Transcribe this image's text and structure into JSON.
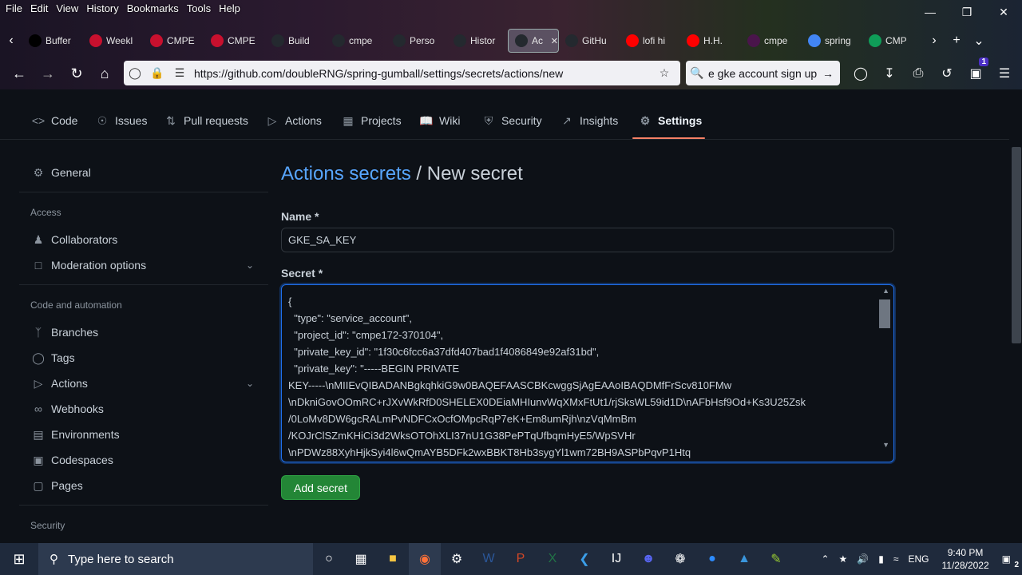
{
  "browser": {
    "menu": [
      "File",
      "Edit",
      "View",
      "History",
      "Bookmarks",
      "Tools",
      "Help"
    ],
    "tabs": [
      {
        "label": "Buffer",
        "color": "#000000"
      },
      {
        "label": "Weekl",
        "color": "#c8102e"
      },
      {
        "label": "CMPE",
        "color": "#c8102e"
      },
      {
        "label": "CMPE",
        "color": "#c8102e"
      },
      {
        "label": "Build",
        "color": "#24292f"
      },
      {
        "label": "cmpe",
        "color": "#24292f"
      },
      {
        "label": "Perso",
        "color": "#24292f"
      },
      {
        "label": "Histor",
        "color": "#24292f"
      },
      {
        "label": "Ac",
        "color": "#24292f",
        "active": true
      },
      {
        "label": "GitHu",
        "color": "#24292f"
      },
      {
        "label": "lofi hi",
        "color": "#ff0000"
      },
      {
        "label": "H.H.",
        "color": "#ff0000"
      },
      {
        "label": "cmpe",
        "color": "#4a154b"
      },
      {
        "label": "spring",
        "color": "#4285f4"
      },
      {
        "label": "CMP",
        "color": "#0f9d58"
      }
    ],
    "url": "https://github.com/doubleRNG/spring-gumball/settings/secrets/actions/new",
    "search_text": "e gke account sign up",
    "notification_count": "1"
  },
  "repo_nav": [
    {
      "label": "Code",
      "icon": "code-icon"
    },
    {
      "label": "Issues",
      "icon": "issue-icon"
    },
    {
      "label": "Pull requests",
      "icon": "pull-request-icon"
    },
    {
      "label": "Actions",
      "icon": "actions-icon"
    },
    {
      "label": "Projects",
      "icon": "projects-icon"
    },
    {
      "label": "Wiki",
      "icon": "book-icon"
    },
    {
      "label": "Security",
      "icon": "shield-icon"
    },
    {
      "label": "Insights",
      "icon": "graph-icon"
    },
    {
      "label": "Settings",
      "icon": "gear-icon",
      "active": true
    }
  ],
  "sidebar": {
    "general": "General",
    "access_heading": "Access",
    "collaborators": "Collaborators",
    "moderation": "Moderation options",
    "code_heading": "Code and automation",
    "branches": "Branches",
    "tags": "Tags",
    "actions": "Actions",
    "webhooks": "Webhooks",
    "environments": "Environments",
    "codespaces": "Codespaces",
    "pages": "Pages",
    "security_heading": "Security"
  },
  "main": {
    "breadcrumb_link": "Actions secrets",
    "breadcrumb_sep": " / ",
    "breadcrumb_current": "New secret",
    "name_label": "Name *",
    "name_value": "GKE_SA_KEY",
    "secret_label": "Secret *",
    "secret_value": "{\n  \"type\": \"service_account\",\n  \"project_id\": \"cmpe172-370104\",\n  \"private_key_id\": \"1f30c6fcc6a37dfd407bad1f4086849e92af31bd\",\n  \"private_key\": \"-----BEGIN PRIVATE\nKEY-----\\nMIIEvQIBADANBgkqhkiG9w0BAQEFAASCBKcwggSjAgEAAoIBAQDMfFrScv810FMw\n\\nDkniGovOOmRC+rJXvWkRfD0SHELEX0DEiaMHIunvWqXMxFtUt1/rjSksWL59id1D\\nAFbHsf9Od+Ks3U25Zsk\n/0LoMv8DW6gcRALmPvNDFCxOcfOMpcRqP7eK+Em8umRjh\\nzVqMmBm\n/KOJrClSZmKHiCi3d2WksOTOhXLI37nU1G38PePTqUfbqmHyE5/WpSVHr\n\\nPDWz88XyhHjkSyi4l6wQmAYB5DFk2wxBBKT8Hb3sygYl1wm72BH9ASPbPqvP1Htq",
    "add_button": "Add secret"
  },
  "taskbar": {
    "search_placeholder": "Type here to search",
    "lang": "ENG",
    "time": "9:40 PM",
    "date": "11/28/2022",
    "notif_count": "2"
  }
}
